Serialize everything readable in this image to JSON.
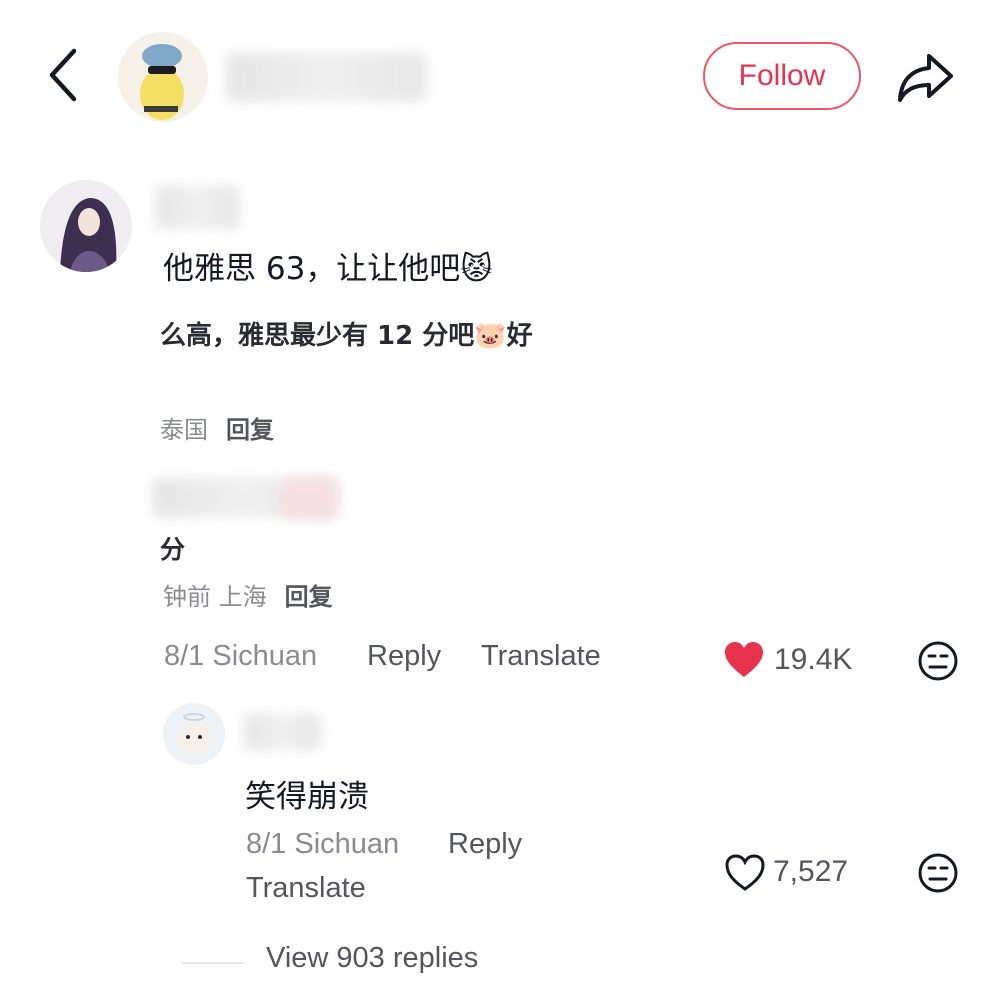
{
  "header": {
    "follow_label": "Follow",
    "icons": {
      "back": "chevron-left-icon",
      "share": "share-arrow-icon"
    },
    "accent_color": "#e8334e"
  },
  "comment": {
    "text": "他雅思 63，让让他吧😾",
    "quoted_text": "么高，雅思最少有 12 分吧🐷好",
    "meta_location_1": "泰国",
    "meta_reply_1": "回复",
    "fragment_text": "分",
    "meta_time_location_2": "钟前 上海",
    "meta_reply_2": "回复",
    "date_location": "8/1 Sichuan",
    "reply_label": "Reply",
    "translate_label": "Translate",
    "likes": "19.4K",
    "liked": true,
    "like_color": "#e8334e"
  },
  "reply": {
    "text": "笑得崩溃",
    "date_location": "8/1 Sichuan",
    "reply_label": "Reply",
    "translate_label": "Translate",
    "likes": "7,527",
    "liked": false
  },
  "view_replies_label": "View 903 replies"
}
